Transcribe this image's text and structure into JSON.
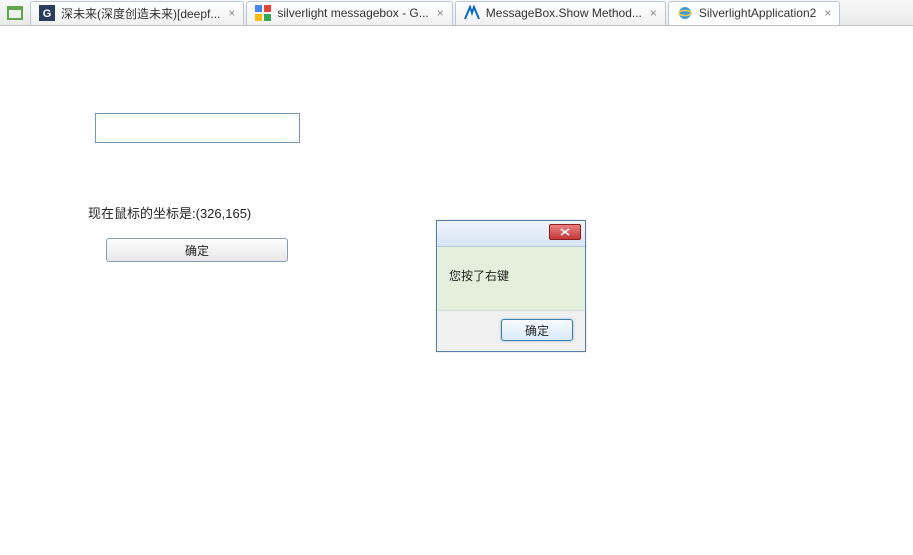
{
  "tabs": [
    {
      "label": "深未来(深度创造未来)[deepf...",
      "favicon": "deepfuture"
    },
    {
      "label": "silverlight messagebox - G...",
      "favicon": "google"
    },
    {
      "label": "MessageBox.Show Method...",
      "favicon": "msdn"
    },
    {
      "label": "SilverlightApplication2",
      "favicon": "ie",
      "active": true
    }
  ],
  "app": {
    "input_value": "",
    "coord_text": "现在鼠标的坐标是:(326,165)",
    "confirm_label": "确定"
  },
  "msgbox": {
    "message": "您按了右键",
    "ok_label": "确定"
  }
}
